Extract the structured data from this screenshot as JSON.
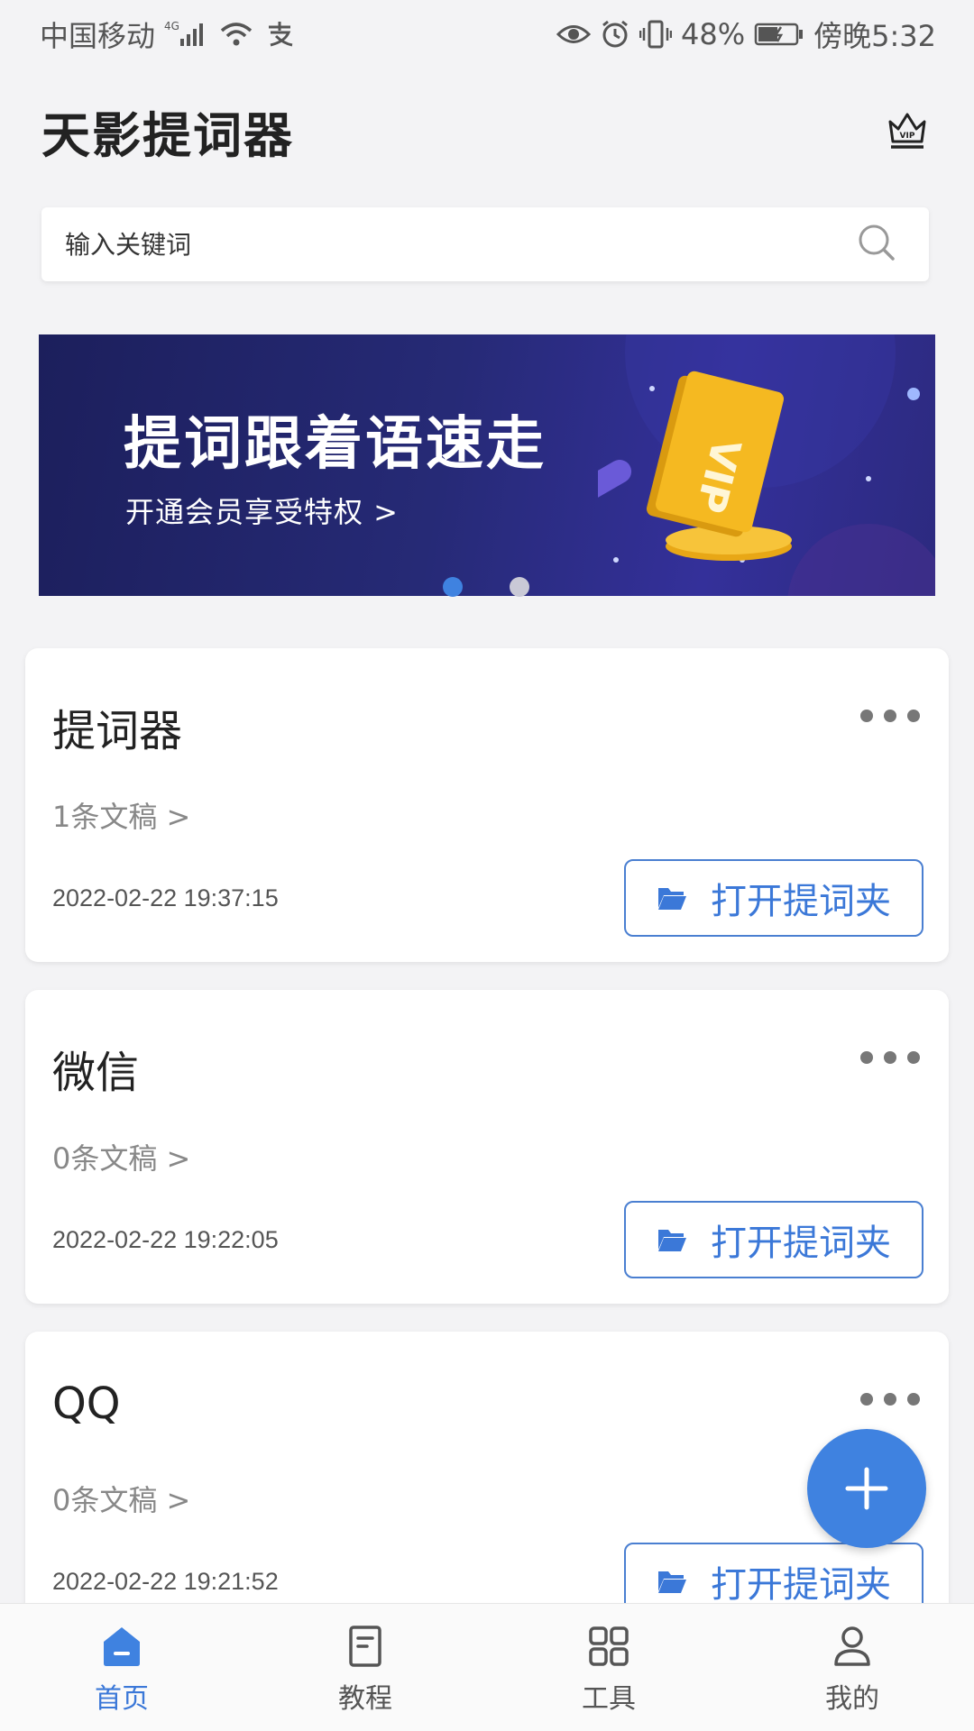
{
  "status_bar": {
    "carrier": "中国移动",
    "network": "4G",
    "battery": "48%",
    "time": "傍晚5:32"
  },
  "header": {
    "title": "天影提词器",
    "vip_label": "VIP"
  },
  "search": {
    "placeholder": "输入关键词"
  },
  "banner": {
    "title": "提词跟着语速走",
    "subtitle": "开通会员享受特权 >",
    "card_text": "VIP",
    "slides": 2,
    "active_slide": 1
  },
  "folders": [
    {
      "name": "提词器",
      "count_label": "1条文稿 >",
      "date": "2022-02-22 19:37:15",
      "open_label": "打开提词夹"
    },
    {
      "name": "微信",
      "count_label": "0条文稿 >",
      "date": "2022-02-22 19:22:05",
      "open_label": "打开提词夹"
    },
    {
      "name": "QQ",
      "count_label": "0条文稿 >",
      "date": "2022-02-22 19:21:52",
      "open_label": "打开提词夹"
    }
  ],
  "bottom_nav": [
    {
      "label": "首页",
      "icon": "home-icon",
      "active": true
    },
    {
      "label": "教程",
      "icon": "document-icon",
      "active": false
    },
    {
      "label": "工具",
      "icon": "grid-icon",
      "active": false
    },
    {
      "label": "我的",
      "icon": "profile-icon",
      "active": false
    }
  ],
  "colors": {
    "accent": "#3b78d8",
    "fab": "#3f82e0",
    "banner_bg": "#262a76",
    "inactive_nav": "#555555"
  }
}
